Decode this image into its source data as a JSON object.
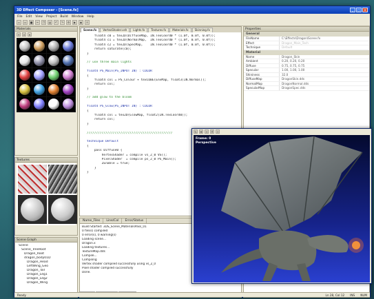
{
  "window": {
    "title": "3D Effect Composer - [Scene.fx]",
    "controls": [
      "_",
      "□",
      "×"
    ]
  },
  "menu": [
    "File",
    "Edit",
    "View",
    "Project",
    "Build",
    "Window",
    "Help"
  ],
  "toolbar_icons": [
    "new-icon",
    "open-icon",
    "save-icon",
    "cut-icon",
    "copy-icon",
    "paste-icon",
    "undo-icon",
    "redo-icon",
    "build-icon",
    "run-icon",
    "camera-icon",
    "light-icon"
  ],
  "materials": {
    "title": "Materials",
    "swatches": [
      "#c8c8c8",
      "#d0a060",
      "#b0b0b0",
      "#6a7ad8",
      "#e8e8e8",
      "#8f8fa8",
      "#c0c0c0",
      "#5070b0",
      "#e04040",
      "#a0a0ff",
      "#70d070",
      "#d080d0",
      "#d8c040",
      "#40a0e0",
      "#e08030",
      "#a040c0",
      "#c04080",
      "#8080ff",
      "#ffffff",
      "#c090e0"
    ]
  },
  "textures": {
    "title": "Textures"
  },
  "scene": {
    "title": "Scene Graph",
    "tree": [
      {
        "level": 1,
        "label": "Scene"
      },
      {
        "level": 2,
        "label": "Scene_TreeRoot"
      },
      {
        "level": 3,
        "label": "Dragon_Root"
      },
      {
        "level": 3,
        "label": "dragon_body01D"
      },
      {
        "level": 4,
        "label": "Dragon_Head"
      },
      {
        "level": 4,
        "label": "LeftWing_Geo"
      },
      {
        "level": 4,
        "label": "Dragon_Tail"
      },
      {
        "level": 4,
        "label": "Dragon_Leg1"
      },
      {
        "level": 4,
        "label": "Dragon_Leg2"
      },
      {
        "level": 4,
        "label": "Dragon_Wing"
      }
    ]
  },
  "editor": {
    "tabs": [
      "Scene.fx",
      "VertexShader.vsh",
      "Lights.fx",
      "Textures.fx",
      "Materials.fx",
      "Skinning.fx"
    ],
    "lines": [
      {
        "cls": "",
        "text": "    float4 c0 = tex2D(DiffuseMap, IN.TexCoord0 * (1.0f, 0.0f, 0.0f));"
      },
      {
        "cls": "",
        "text": "    float4 c1 = tex2D(NormalMap,  IN.TexCoord0 * (1.0f, 0.0f, 0.0f));"
      },
      {
        "cls": "",
        "text": "    float4 c2 = tex2D(SpecMap,    IN.TexCoord0 * (1.0f, 0.0f, 0.0f));"
      },
      {
        "cls": "",
        "text": "    return saturate(c0);"
      },
      {
        "cls": "",
        "text": "}"
      },
      {
        "cls": "",
        "text": ""
      },
      {
        "cls": "cm",
        "text": "// use three main lights"
      },
      {
        "cls": "",
        "text": ""
      },
      {
        "cls": "kw",
        "text": "float4 PS_Main(PS_INPUT IN) : COLOR"
      },
      {
        "cls": "",
        "text": "{"
      },
      {
        "cls": "",
        "text": "    float4 col = PS_Colour + texCUBE(EnvMap, float3(IN.Normal));"
      },
      {
        "cls": "",
        "text": "    return col;"
      },
      {
        "cls": "",
        "text": "}"
      },
      {
        "cls": "",
        "text": ""
      },
      {
        "cls": "cm",
        "text": "// add glow to the bloom"
      },
      {
        "cls": "",
        "text": ""
      },
      {
        "cls": "kw",
        "text": "float4 PS_Glow(PS_INPUT IN) : COLOR"
      },
      {
        "cls": "",
        "text": "{"
      },
      {
        "cls": "",
        "text": "    float4 col = tex2D(GlowMap, float2(IN.TexCoord0));"
      },
      {
        "cls": "",
        "text": "    return col;"
      },
      {
        "cls": "",
        "text": "}"
      },
      {
        "cls": "",
        "text": ""
      },
      {
        "cls": "cm",
        "text": "//////////////////////////////////////////////"
      },
      {
        "cls": "",
        "text": ""
      },
      {
        "cls": "kw",
        "text": "technique Default"
      },
      {
        "cls": "",
        "text": "{"
      },
      {
        "cls": "",
        "text": "    pass Diffuse0 {"
      },
      {
        "cls": "",
        "text": "        VertexShader = compile vs_2_0 VS();"
      },
      {
        "cls": "",
        "text": "        PixelShader  = compile ps_2_0 PS_Main();"
      },
      {
        "cls": "",
        "text": "        ZEnable = true;"
      },
      {
        "cls": "",
        "text": "    }"
      },
      {
        "cls": "",
        "text": "}"
      }
    ]
  },
  "output": {
    "columns": [
      "Name_Files",
      "Line/Col",
      "Error/Status"
    ],
    "lines": [
      "Build Started: 3DS_Scene_MaterialsPass_01",
      "0 file(s) compiled",
      "0 error(s), 0 warning(s)",
      "Loading scene...",
      "Dragon.x",
      "Loading textures...",
      "TextureMap.dds",
      "Compile...",
      "Compiling",
      "Vertex shader compiled successfully using vs_2_0",
      "Pixel shader compiled successfully",
      "Done."
    ],
    "tabs": [
      "Output",
      "Find Results",
      "Build Log"
    ]
  },
  "properties": {
    "title": "Properties",
    "sections": [
      {
        "name": "General",
        "rows": [
          {
            "k": "FileName",
            "v": "C:\\Effects\\Dragon\\Scene.fx",
            "dim": false
          },
          {
            "k": "Effect",
            "v": "Dragon_Main_Tech",
            "dim": true
          },
          {
            "k": "Technique",
            "v": "Default",
            "dim": true
          }
        ]
      },
      {
        "name": "Material",
        "rows": [
          {
            "k": "Name",
            "v": "Dragon_Skin",
            "dim": false
          },
          {
            "k": "Ambient",
            "v": "0.20, 0.20, 0.20",
            "dim": false
          },
          {
            "k": "Diffuse",
            "v": "0.75, 0.75, 0.75",
            "dim": false
          },
          {
            "k": "Specular",
            "v": "1.00, 1.00, 1.00",
            "dim": false
          },
          {
            "k": "Shininess",
            "v": "32.0",
            "dim": false
          },
          {
            "k": "DiffuseMap",
            "v": "DragonSkin.dds",
            "dim": false
          },
          {
            "k": "NormalMap",
            "v": "DragonNormal.dds",
            "dim": false
          },
          {
            "k": "SpecularMap",
            "v": "DragonSpec.dds",
            "dim": false
          }
        ]
      }
    ]
  },
  "viewport": {
    "overlay_line1": "Frame: 0",
    "overlay_line2": "Perspective"
  },
  "status": [
    "Ready",
    "Ln 28, Col 12",
    "INS",
    "NUM"
  ]
}
